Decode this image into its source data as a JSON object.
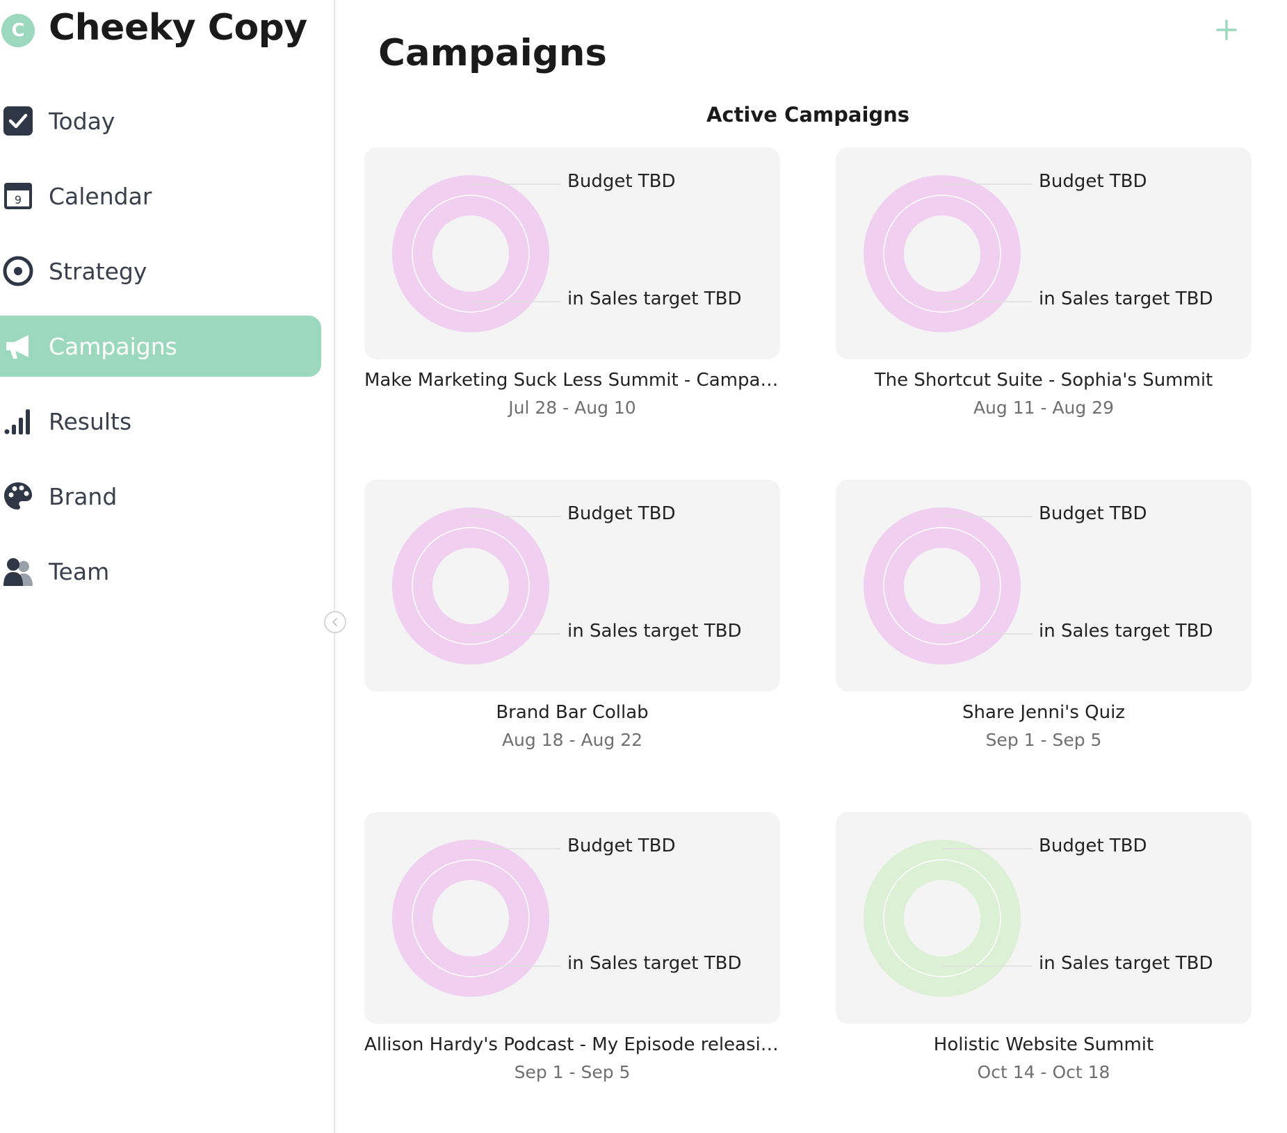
{
  "app": {
    "logo_letter": "C",
    "name": "Cheeky Copy"
  },
  "sidebar": {
    "items": [
      {
        "label": "Today",
        "icon": "checkbox-icon",
        "active": false
      },
      {
        "label": "Calendar",
        "icon": "calendar-icon",
        "icon_text": "9",
        "active": false
      },
      {
        "label": "Strategy",
        "icon": "target-icon",
        "active": false
      },
      {
        "label": "Campaigns",
        "icon": "megaphone-icon",
        "active": true
      },
      {
        "label": "Results",
        "icon": "bar-signal-icon",
        "active": false
      },
      {
        "label": "Brand",
        "icon": "palette-icon",
        "active": false
      },
      {
        "label": "Team",
        "icon": "team-icon",
        "active": false
      }
    ]
  },
  "header": {
    "title": "Campaigns",
    "add_icon": "plus-icon"
  },
  "section": {
    "title": "Active Campaigns"
  },
  "colors": {
    "accent": "#9bd8bd",
    "ring_pink": "#f0cff0",
    "ring_green": "#dcf0d6",
    "card_bg": "#f4f4f4",
    "nav_text": "#3a3f4b"
  },
  "campaigns": [
    {
      "title": "Make Marketing Suck Less Summit - Campaign",
      "dates": "Jul 28 - Aug 10",
      "budget": "Budget TBD",
      "sales": "in Sales target TBD",
      "ring_color": "#f0cff0"
    },
    {
      "title": "The Shortcut Suite - Sophia's Summit",
      "dates": "Aug 11 - Aug 29",
      "budget": "Budget TBD",
      "sales": "in Sales target TBD",
      "ring_color": "#f0cff0"
    },
    {
      "title": "Brand Bar Collab",
      "dates": "Aug 18 - Aug 22",
      "budget": "Budget TBD",
      "sales": "in Sales target TBD",
      "ring_color": "#f0cff0"
    },
    {
      "title": "Share Jenni's Quiz",
      "dates": "Sep 1 - Sep 5",
      "budget": "Budget TBD",
      "sales": "in Sales target TBD",
      "ring_color": "#f0cff0"
    },
    {
      "title": "Allison Hardy's Podcast - My Episode releasing",
      "dates": "Sep 1 - Sep 5",
      "budget": "Budget TBD",
      "sales": "in Sales target TBD",
      "ring_color": "#f0cff0"
    },
    {
      "title": "Holistic Website Summit",
      "dates": "Oct 14 - Oct 18",
      "budget": "Budget TBD",
      "sales": "in Sales target TBD",
      "ring_color": "#dcf0d6"
    }
  ]
}
